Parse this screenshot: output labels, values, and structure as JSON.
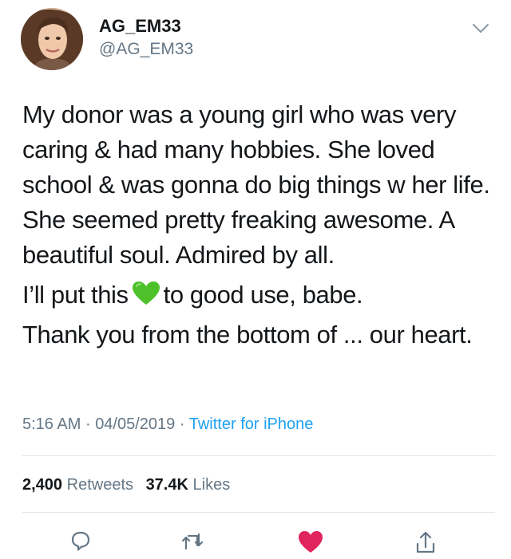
{
  "tweet": {
    "display_name": "AG_EM33",
    "handle": "@AG_EM33",
    "body": {
      "paragraph1": "My donor was a young girl who was very caring & had many hobbies. She loved school & was gonna do big things w her life. She seemed pretty freaking awesome. A beautiful soul. Admired by all.",
      "paragraph2_before": "I’ll put this",
      "paragraph2_emoji": "green-heart-emoji",
      "paragraph2_after": "to good use, babe.",
      "paragraph3": "Thank you from the bottom of ... our heart."
    },
    "meta": {
      "time": "5:16 AM",
      "separator": "·",
      "date": "04/05/2019",
      "source": "Twitter for iPhone"
    },
    "stats": {
      "retweets_count": "2,400",
      "retweets_label": "Retweets",
      "likes_count": "37.4K",
      "likes_label": "Likes"
    },
    "icons": {
      "caret": "chevron-down-icon",
      "reply": "reply-icon",
      "retweet": "retweet-icon",
      "like": "heart-icon",
      "share": "share-icon"
    },
    "colors": {
      "link": "#1da1f2",
      "secondary_text": "#657786",
      "like_active": "#e0245e",
      "emoji_green": "#4cc12a"
    }
  }
}
